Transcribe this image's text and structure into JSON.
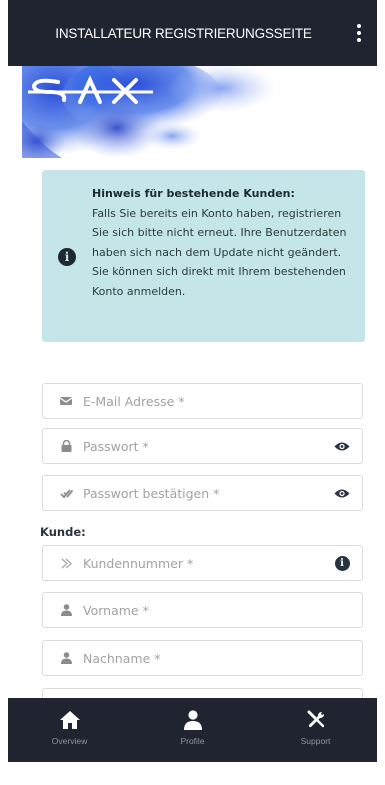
{
  "appbar": {
    "title": "INSTALLATEUR REGISTRIERUNGSSEITE",
    "menu_icon": "kebab-menu-icon"
  },
  "hero": {
    "logo_text": "SAX",
    "icon": "sax-logo-icon"
  },
  "notice": {
    "icon": "info-circle-icon",
    "title": "Hinweis für bestehende Kunden:",
    "body": "Falls Sie bereits ein Konto haben, registrieren Sie sich bitte nicht erneut. Ihre Benutzerdaten haben sich nach dem Update nicht geändert. Sie können sich direkt mit Ihrem bestehenden Konto anmelden."
  },
  "form": {
    "email": {
      "placeholder": "E-Mail Adresse *",
      "value": "",
      "icon": "envelope-icon"
    },
    "password": {
      "placeholder": "Passwort *",
      "value": "",
      "icon": "lock-icon",
      "trail_icon": "eye-icon"
    },
    "password_confirm": {
      "placeholder": "Passwort bestätigen *",
      "value": "",
      "icon": "double-check-icon",
      "trail_icon": "eye-icon"
    },
    "customer_section_label": "Kunde:",
    "customer_number": {
      "placeholder": "Kundennummer *",
      "value": "",
      "icon": "chevron-right-icon",
      "trail_icon": "info-circle-icon"
    },
    "first_name": {
      "placeholder": "Vorname *",
      "value": "",
      "icon": "user-icon"
    },
    "last_name": {
      "placeholder": "Nachname *",
      "value": "",
      "icon": "user-icon"
    }
  },
  "bottom_nav": {
    "items": [
      {
        "label": "Overview",
        "icon": "home-icon"
      },
      {
        "label": "Profile",
        "icon": "user-icon"
      },
      {
        "label": "Support",
        "icon": "tools-icon"
      }
    ]
  },
  "colors": {
    "appbar_bg": "#202431",
    "notice_bg": "#c5e6e8",
    "hero_blue": "#2f56d8",
    "nav_label": "#8f93a0"
  }
}
